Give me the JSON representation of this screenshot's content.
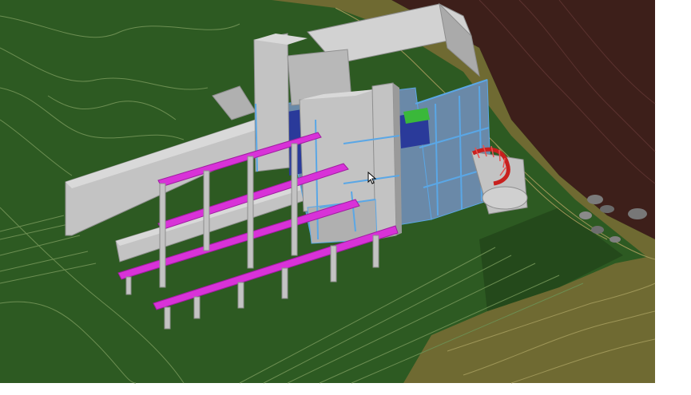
{
  "viewport": {
    "background": "#ffffff"
  },
  "colors": {
    "lawn": "#2d5a22",
    "lawn_dark": "#24491b",
    "contour_green": "#6c8e52",
    "slope_olive": "#6f6a32",
    "contour_olive": "#9e9658",
    "ground_brown": "#3d1f1a",
    "contour_brown": "#5c3330",
    "concrete": "#c3c3c3",
    "concrete_light": "#d9d9d9",
    "concrete_dark": "#8e8e8e",
    "frame_blue": "#5aa7e6",
    "glass_blue": "#2a3a9a",
    "ramp_magenta": "#d832d8",
    "stair_red": "#c8201e",
    "accent_green": "#3ab83a"
  },
  "cursor": {
    "icon": "mouse-pointer-icon"
  }
}
